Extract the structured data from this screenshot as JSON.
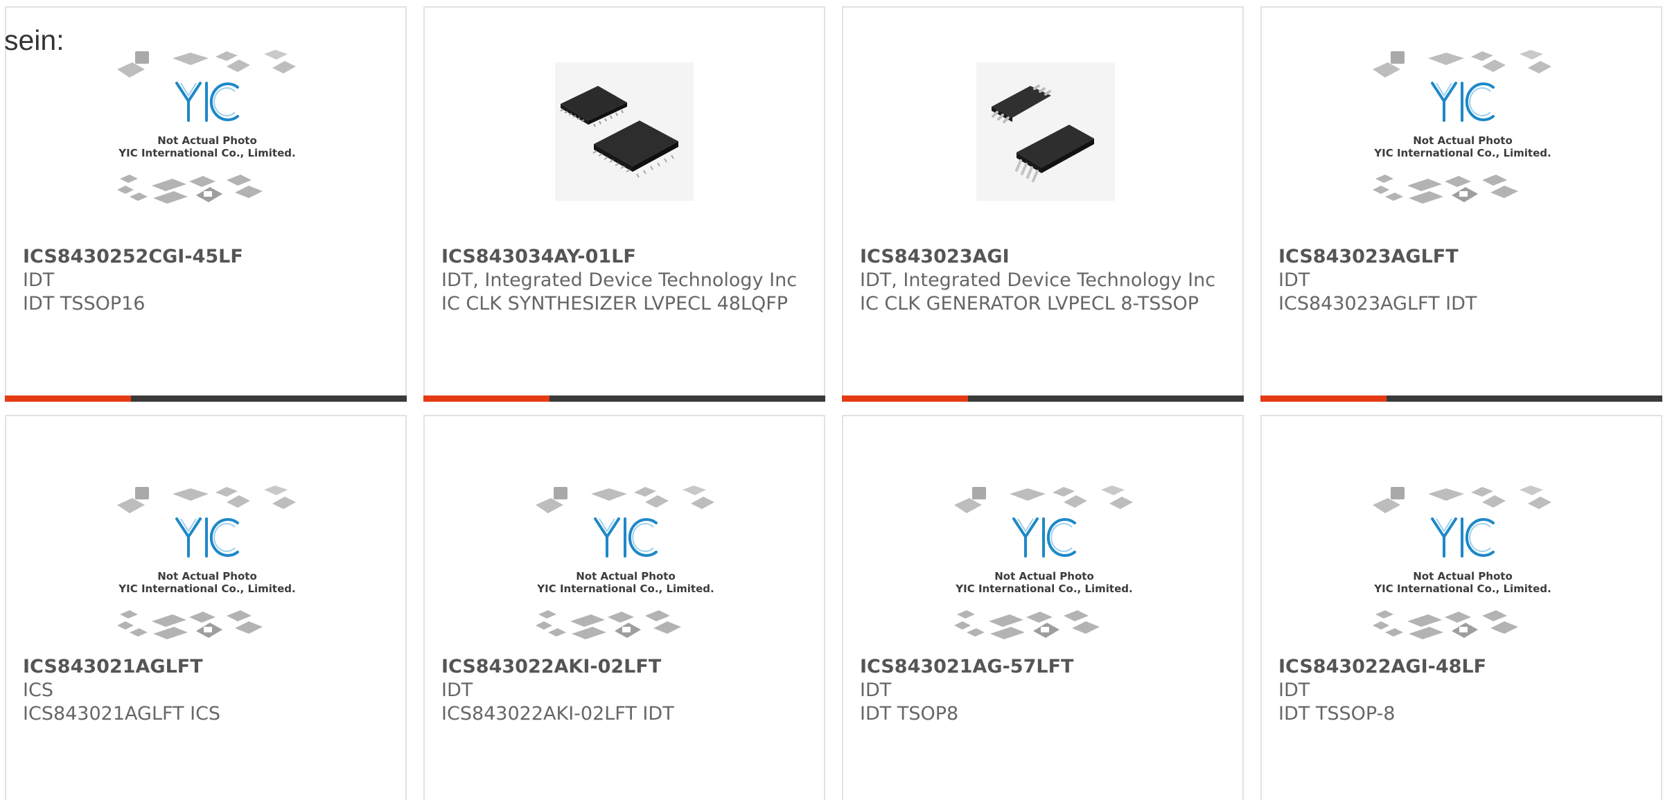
{
  "heading": "sein:",
  "placeholder": {
    "line1": "Not Actual Photo",
    "line2": "YIC International Co., Limited.",
    "logo": "YIC"
  },
  "colors": {
    "accent": "#e43b14",
    "bar": "#3a3a3a",
    "logo_blue": "#1e88c8",
    "text": "#666666"
  },
  "products": [
    {
      "part": "ICS8430252CGI-45LF",
      "brand": "IDT",
      "desc": "IDT TSSOP16",
      "image": "placeholder"
    },
    {
      "part": "ICS843034AY-01LF",
      "brand": "IDT, Integrated Device Technology Inc",
      "desc": "IC CLK SYNTHESIZER LVPECL 48LQFP",
      "image": "qfp-chips"
    },
    {
      "part": "ICS843023AGI",
      "brand": "IDT, Integrated Device Technology Inc",
      "desc": "IC CLK GENERATOR LVPECL 8-TSSOP",
      "image": "tssop-chips"
    },
    {
      "part": "ICS843023AGLFT",
      "brand": "IDT",
      "desc": "ICS843023AGLFT IDT",
      "image": "placeholder"
    },
    {
      "part": "ICS843021AGLFT",
      "brand": "ICS",
      "desc": "ICS843021AGLFT ICS",
      "image": "placeholder"
    },
    {
      "part": "ICS843022AKI-02LFT",
      "brand": "IDT",
      "desc": "ICS843022AKI-02LFT IDT",
      "image": "placeholder"
    },
    {
      "part": "ICS843021AG-57LFT",
      "brand": "IDT",
      "desc": "IDT TSOP8",
      "image": "placeholder"
    },
    {
      "part": "ICS843022AGI-48LF",
      "brand": "IDT",
      "desc": "IDT TSSOP-8",
      "image": "placeholder"
    }
  ]
}
